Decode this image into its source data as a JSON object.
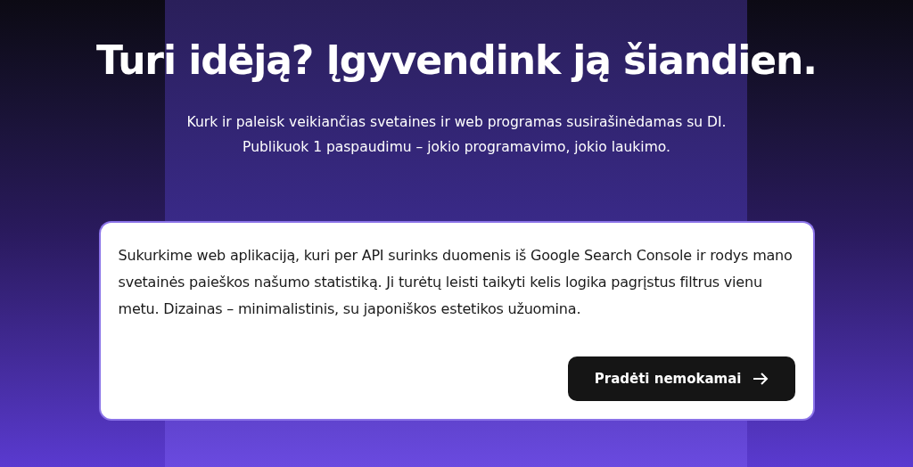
{
  "hero": {
    "title": "Turi idėją? Įgyvendink ją šiandien.",
    "subtitle_lines": [
      "Kurk ir paleisk veikiančias svetaines ir web programas susirašinėdamas su DI.",
      "Publikuok 1 paspaudimu – jokio programavimo, jokio laukimo."
    ]
  },
  "prompt": {
    "value": "Sukurkime web aplikaciją, kuri per API surinks duomenis iš Google Search Console ir rodys mano svetainės paieškos našumo statistiką. Ji turėtų leisti taikyti kelis logika pagrįstus filtrus vienu metu. Dizainas – minimalistinis, su japoniškos estetikos užuomina.",
    "button": "Pradėti nemokamai"
  }
}
